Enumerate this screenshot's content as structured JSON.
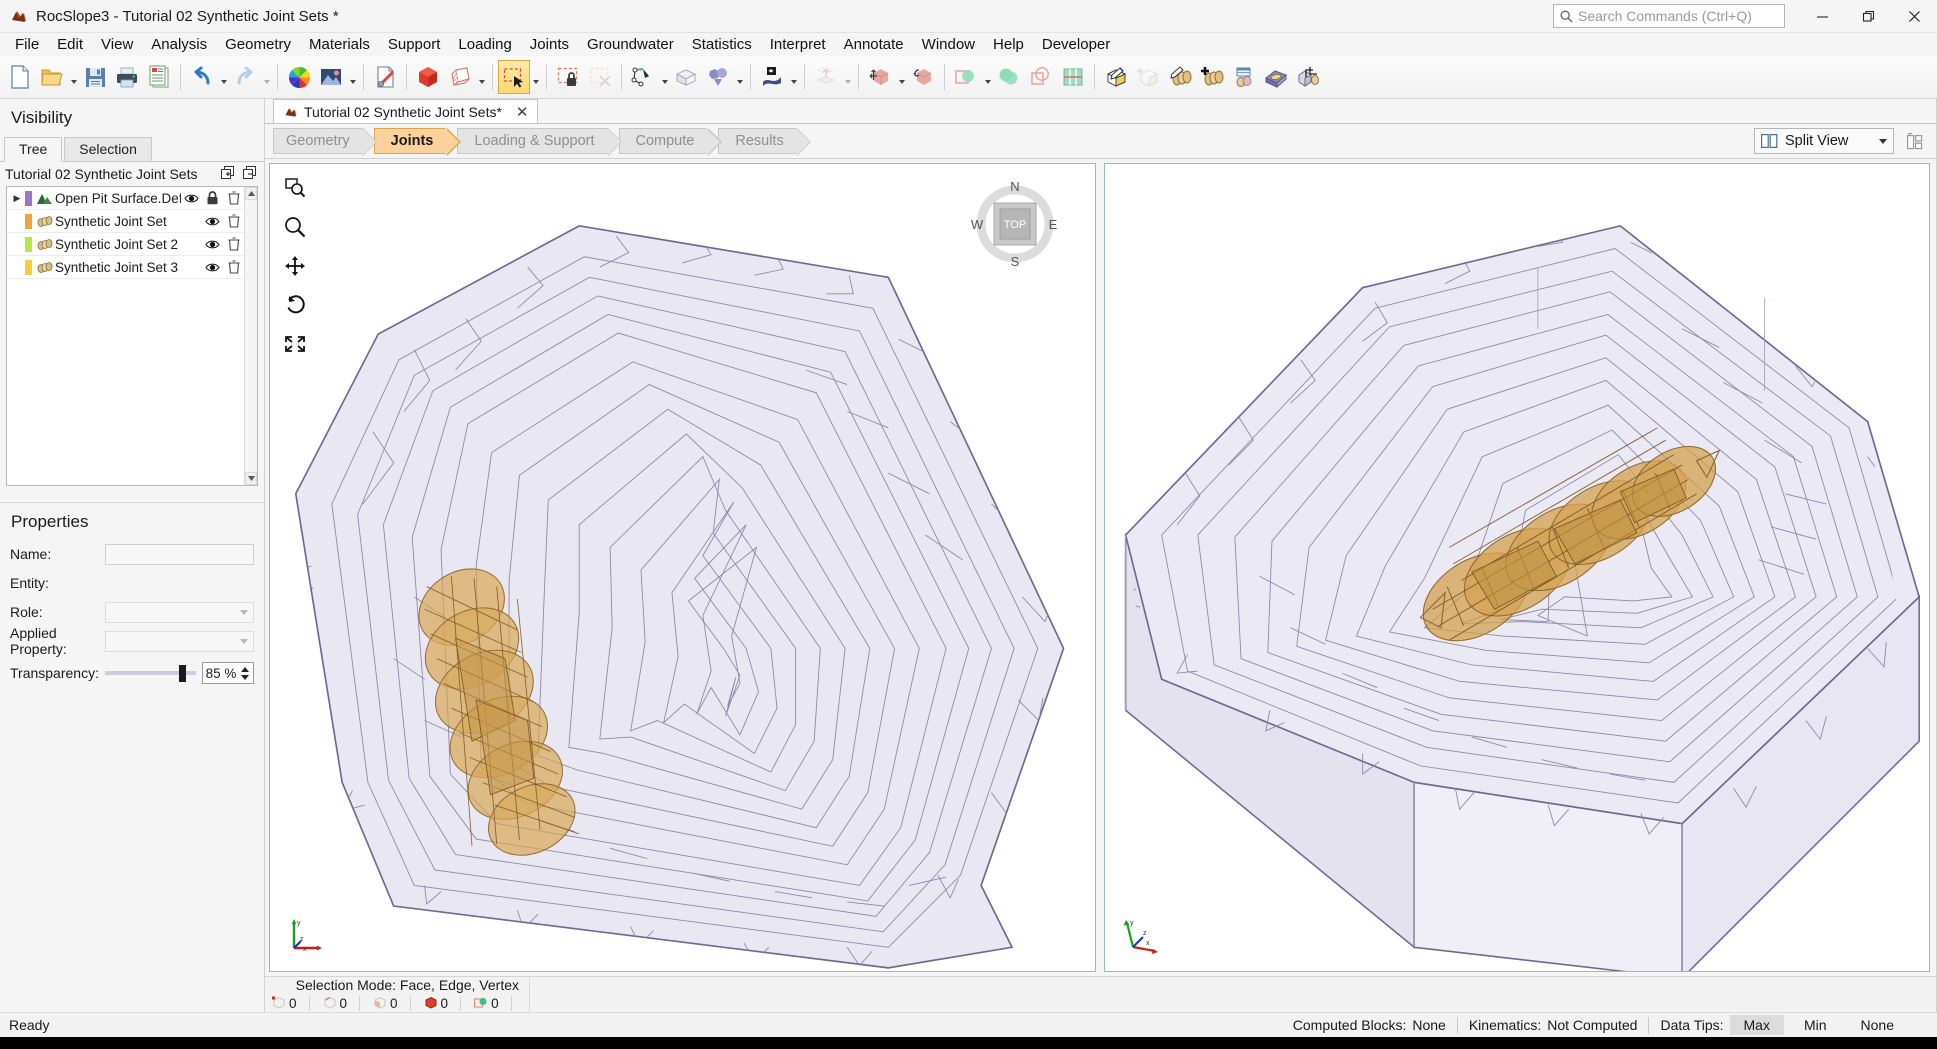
{
  "window": {
    "app_name": "RocSlope3",
    "title": "RocSlope3 - Tutorial 02 Synthetic Joint Sets *",
    "app_icon": "rocslope-icon",
    "search_placeholder": "Search Commands (Ctrl+Q)",
    "minimize_label": "minimize-icon",
    "maximize_label": "restore-icon",
    "close_label": "close-icon"
  },
  "menubar": {
    "items": [
      {
        "label": "File"
      },
      {
        "label": "Edit"
      },
      {
        "label": "View"
      },
      {
        "label": "Analysis"
      },
      {
        "label": "Geometry"
      },
      {
        "label": "Materials"
      },
      {
        "label": "Support"
      },
      {
        "label": "Loading"
      },
      {
        "label": "Joints"
      },
      {
        "label": "Groundwater"
      },
      {
        "label": "Statistics"
      },
      {
        "label": "Interpret"
      },
      {
        "label": "Annotate"
      },
      {
        "label": "Window"
      },
      {
        "label": "Help"
      },
      {
        "label": "Developer"
      }
    ]
  },
  "toolbar": {
    "groups": [
      {
        "buttons": [
          {
            "name": "new-file-icon",
            "tip": "New"
          },
          {
            "name": "open-folder-icon",
            "tip": "Open",
            "caret": true
          },
          {
            "name": "save-icon",
            "tip": "Save"
          },
          {
            "name": "print-icon",
            "tip": "Print"
          },
          {
            "name": "report-icon",
            "tip": "Report Generator"
          }
        ]
      },
      {
        "buttons": [
          {
            "name": "undo-icon",
            "tip": "Undo",
            "caret": true
          },
          {
            "name": "redo-icon",
            "tip": "Redo",
            "caret": true,
            "disabled": true
          }
        ]
      },
      {
        "buttons": [
          {
            "name": "color-wheel-icon",
            "tip": "Display Options"
          },
          {
            "name": "image-export-icon",
            "tip": "Copy Image",
            "caret": true
          }
        ]
      },
      {
        "buttons": [
          {
            "name": "project-settings-icon",
            "tip": "Project Settings"
          }
        ]
      },
      {
        "buttons": [
          {
            "name": "solid-cube-icon",
            "tip": "Show Solids"
          },
          {
            "name": "wireframe-cube-icon",
            "tip": "Show Mesh",
            "caret": true
          }
        ]
      },
      {
        "buttons": [
          {
            "name": "select-rectangle-icon",
            "tip": "Selection Mode",
            "selected": true,
            "caret": true
          }
        ]
      },
      {
        "buttons": [
          {
            "name": "lock-selection-icon",
            "tip": "Lock Selection"
          },
          {
            "name": "clear-selection-icon",
            "tip": "Clear Selection",
            "disabled": true
          }
        ]
      },
      {
        "buttons": [
          {
            "name": "polyline-icon",
            "tip": "Add Polyline",
            "caret": true
          },
          {
            "name": "open-box-icon",
            "tip": "Add Box"
          },
          {
            "name": "boolean-shapes-icon",
            "tip": "Boolean Operations",
            "caret": true
          }
        ]
      },
      {
        "buttons": [
          {
            "name": "import-surface-icon",
            "tip": "Import Geometry",
            "caret": true
          }
        ]
      },
      {
        "buttons": [
          {
            "name": "extrude-icon",
            "tip": "Extrude",
            "caret": true,
            "disabled": true
          }
        ]
      },
      {
        "buttons": [
          {
            "name": "move-object-icon",
            "tip": "Move",
            "caret": true
          },
          {
            "name": "rotate-object-icon",
            "tip": "Rotate"
          }
        ]
      },
      {
        "buttons": [
          {
            "name": "intersect-icon",
            "tip": "Intersection",
            "caret": true
          },
          {
            "name": "union-icon",
            "tip": "Union"
          },
          {
            "name": "subtract-icon",
            "tip": "Subtract"
          },
          {
            "name": "grid-icon",
            "tip": "Grid"
          }
        ]
      },
      {
        "buttons": [
          {
            "name": "edit-block-icon",
            "tip": "Edit Block"
          },
          {
            "name": "add-block-icon",
            "tip": "Add Block",
            "disabled": true
          },
          {
            "name": "edit-joint-set-icon",
            "tip": "Edit Joint Set"
          },
          {
            "name": "add-joint-set-icon",
            "tip": "Add Joint Set"
          },
          {
            "name": "joint-statistics-icon",
            "tip": "Joint Statistics"
          },
          {
            "name": "joint-network-icon",
            "tip": "Joint Network"
          },
          {
            "name": "crop-joints-icon",
            "tip": "Crop Joints"
          }
        ]
      }
    ]
  },
  "visibility_panel": {
    "title": "Visibility",
    "tabs": [
      {
        "label": "Tree",
        "active": true
      },
      {
        "label": "Selection",
        "active": false
      }
    ],
    "tree_header": {
      "label": "Tutorial 02 Synthetic Joint Sets",
      "expand_all_icon": "expand-all-icon",
      "collapse_all_icon": "collapse-all-icon"
    },
    "tree_items": [
      {
        "label": "Open Pit Surface.Default.Mesh_rep",
        "swatch": "#9b76c4",
        "icon": "terrain-mesh-icon",
        "has_twisty": true,
        "eye": true,
        "lock": true,
        "delete": true
      },
      {
        "label": "Synthetic Joint Set",
        "swatch": "#f0a33c",
        "icon": "joint-set-icon",
        "has_twisty": false,
        "eye": true,
        "lock": false,
        "delete": true
      },
      {
        "label": "Synthetic Joint Set 2",
        "swatch": "#b6e84a",
        "icon": "joint-set-icon",
        "has_twisty": false,
        "eye": true,
        "lock": false,
        "delete": true
      },
      {
        "label": "Synthetic Joint Set 3",
        "swatch": "#f2d03a",
        "icon": "joint-set-icon",
        "has_twisty": false,
        "eye": true,
        "lock": false,
        "delete": true
      }
    ]
  },
  "properties_panel": {
    "title": "Properties",
    "fields": [
      {
        "label": "Name:",
        "value": "",
        "type": "text"
      },
      {
        "label": "Entity:",
        "value": "",
        "type": "static"
      },
      {
        "label": "Role:",
        "value": "",
        "type": "combo"
      },
      {
        "label": "Applied Property:",
        "value": "",
        "type": "combo"
      }
    ],
    "transparency": {
      "label": "Transparency:",
      "value": "85 %",
      "percent": 85
    }
  },
  "document_tab": {
    "label": "Tutorial 02 Synthetic Joint Sets*",
    "icon": "rocslope-icon",
    "close_icon": "close-icon"
  },
  "workflow": {
    "steps": [
      {
        "label": "Geometry",
        "active": false
      },
      {
        "label": "Joints",
        "active": true
      },
      {
        "label": "Loading & Support",
        "active": false
      },
      {
        "label": "Compute",
        "active": false
      },
      {
        "label": "Results",
        "active": false
      }
    ]
  },
  "view_controls": {
    "split_view": {
      "label": "Split View",
      "icon": "split-view-icon",
      "caret": "chevron-down-icon"
    },
    "layout_button": "view-layout-icon"
  },
  "viewport": {
    "tools": [
      {
        "name": "zoom-window-icon"
      },
      {
        "name": "zoom-icon"
      },
      {
        "name": "pan-icon"
      },
      {
        "name": "rotate-icon"
      },
      {
        "name": "zoom-all-icon"
      }
    ],
    "view_cube": {
      "face": "TOP",
      "north": "N",
      "south": "S",
      "east": "E",
      "west": "W"
    },
    "axes": {
      "x": "x",
      "y": "y",
      "z": "z"
    },
    "left_view_name": "top-view-viewport",
    "right_view_name": "perspective-view-viewport",
    "colors": {
      "terrain_fill": "#e8e6f0",
      "terrain_stroke": "#8d87a8",
      "joint_fill": "#d2a04a",
      "joint_stroke": "#8f6420",
      "view_border": "#9fb3c8"
    }
  },
  "selection_bar": {
    "mode_label": "Selection Mode:  Face, Edge, Vertex",
    "counters": [
      {
        "icon": "vertex-count-icon",
        "value": "0"
      },
      {
        "icon": "edge-count-icon",
        "value": "0"
      },
      {
        "icon": "face-count-icon",
        "value": "0"
      },
      {
        "icon": "block-count-icon",
        "value": "0"
      },
      {
        "icon": "joint-count-icon",
        "value": "0"
      }
    ]
  },
  "statusbar": {
    "message": "Ready",
    "computed_blocks_label": "Computed Blocks:",
    "computed_blocks_value": "None",
    "kinematics_label": "Kinematics:",
    "kinematics_value": "Not Computed",
    "data_tips_label": "Data Tips:",
    "data_tips_options": [
      {
        "label": "Max",
        "active": true
      },
      {
        "label": "Min",
        "active": false
      },
      {
        "label": "None",
        "active": false
      }
    ]
  }
}
